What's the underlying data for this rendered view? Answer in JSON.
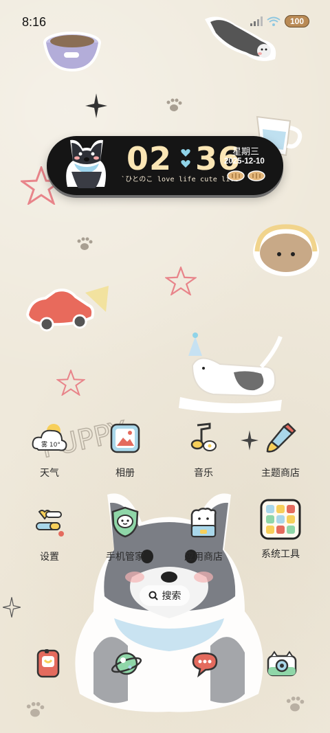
{
  "status_bar": {
    "time": "8:16",
    "battery": "100"
  },
  "clock_widget": {
    "hour": "02",
    "minute": "36",
    "weekday": "星期三",
    "date": "2025-12-10",
    "tagline": "`ひとのこ love life cute life"
  },
  "apps": [
    {
      "label": "天气",
      "icon": "weather-cloud-icon",
      "badge": "雾 10°"
    },
    {
      "label": "相册",
      "icon": "gallery-icon"
    },
    {
      "label": "音乐",
      "icon": "music-note-icon"
    },
    {
      "label": "主题商店",
      "icon": "paint-brush-icon"
    },
    {
      "label": "设置",
      "icon": "settings-toggle-icon"
    },
    {
      "label": "手机管家",
      "icon": "phone-manager-shield-icon"
    },
    {
      "label": "应用商店",
      "icon": "app-store-bag-icon"
    },
    {
      "label": "系统工具",
      "icon": "folder-grid-icon"
    }
  ],
  "search": {
    "label": "搜索"
  },
  "dock": [
    {
      "icon": "phone-icon"
    },
    {
      "icon": "browser-planet-icon"
    },
    {
      "icon": "messages-bubble-icon"
    },
    {
      "icon": "camera-icon"
    }
  ],
  "colors": {
    "background": "#efe9db",
    "widget_bg": "#151515",
    "clock_digits": "#fbe6b5",
    "heart": "#8fd3e8",
    "battery": "#b98a55"
  }
}
